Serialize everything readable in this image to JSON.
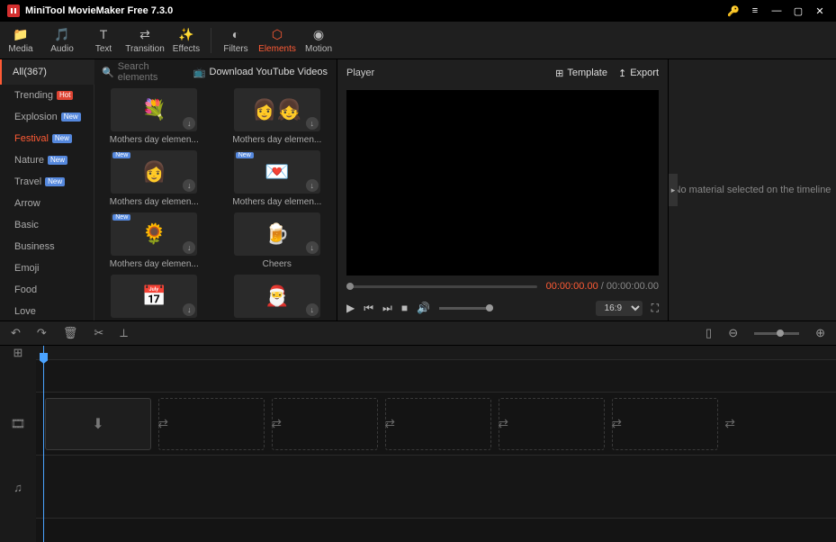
{
  "app": {
    "title": "MiniTool MovieMaker Free 7.3.0"
  },
  "toolbar": {
    "media": "Media",
    "audio": "Audio",
    "text": "Text",
    "transition": "Transition",
    "effects": "Effects",
    "filters": "Filters",
    "elements": "Elements",
    "motion": "Motion"
  },
  "elements": {
    "all_label": "All(367)",
    "search_placeholder": "Search elements",
    "download_yt": "Download YouTube Videos",
    "categories": [
      {
        "name": "Trending",
        "badge": "Hot",
        "badgeCls": "hot"
      },
      {
        "name": "Explosion",
        "badge": "New",
        "badgeCls": "new"
      },
      {
        "name": "Festival",
        "badge": "New",
        "badgeCls": "new",
        "active": true
      },
      {
        "name": "Nature",
        "badge": "New",
        "badgeCls": "new"
      },
      {
        "name": "Travel",
        "badge": "New",
        "badgeCls": "new"
      },
      {
        "name": "Arrow"
      },
      {
        "name": "Basic"
      },
      {
        "name": "Business"
      },
      {
        "name": "Emoji"
      },
      {
        "name": "Food"
      },
      {
        "name": "Love"
      }
    ],
    "items": [
      {
        "name": "Mothers day elemen...",
        "emoji": "💐",
        "new": false
      },
      {
        "name": "Mothers day elemen...",
        "emoji": "👩👧",
        "new": false
      },
      {
        "name": "Mothers day elemen...",
        "emoji": "👩",
        "new": true
      },
      {
        "name": "Mothers day elemen...",
        "emoji": "💌",
        "new": true
      },
      {
        "name": "Mothers day elemen...",
        "emoji": "🌻",
        "new": true
      },
      {
        "name": "Cheers",
        "emoji": "🍺",
        "new": false
      },
      {
        "name": "",
        "emoji": "📅",
        "new": false
      },
      {
        "name": "",
        "emoji": "🎅",
        "new": false
      }
    ]
  },
  "player": {
    "title": "Player",
    "template": "Template",
    "export": "Export",
    "time_cur": "00:00:00.00",
    "time_sep": " / ",
    "time_total": "00:00:00.00",
    "aspect": "16:9"
  },
  "right": {
    "msg": "No material selected on the timeline"
  }
}
